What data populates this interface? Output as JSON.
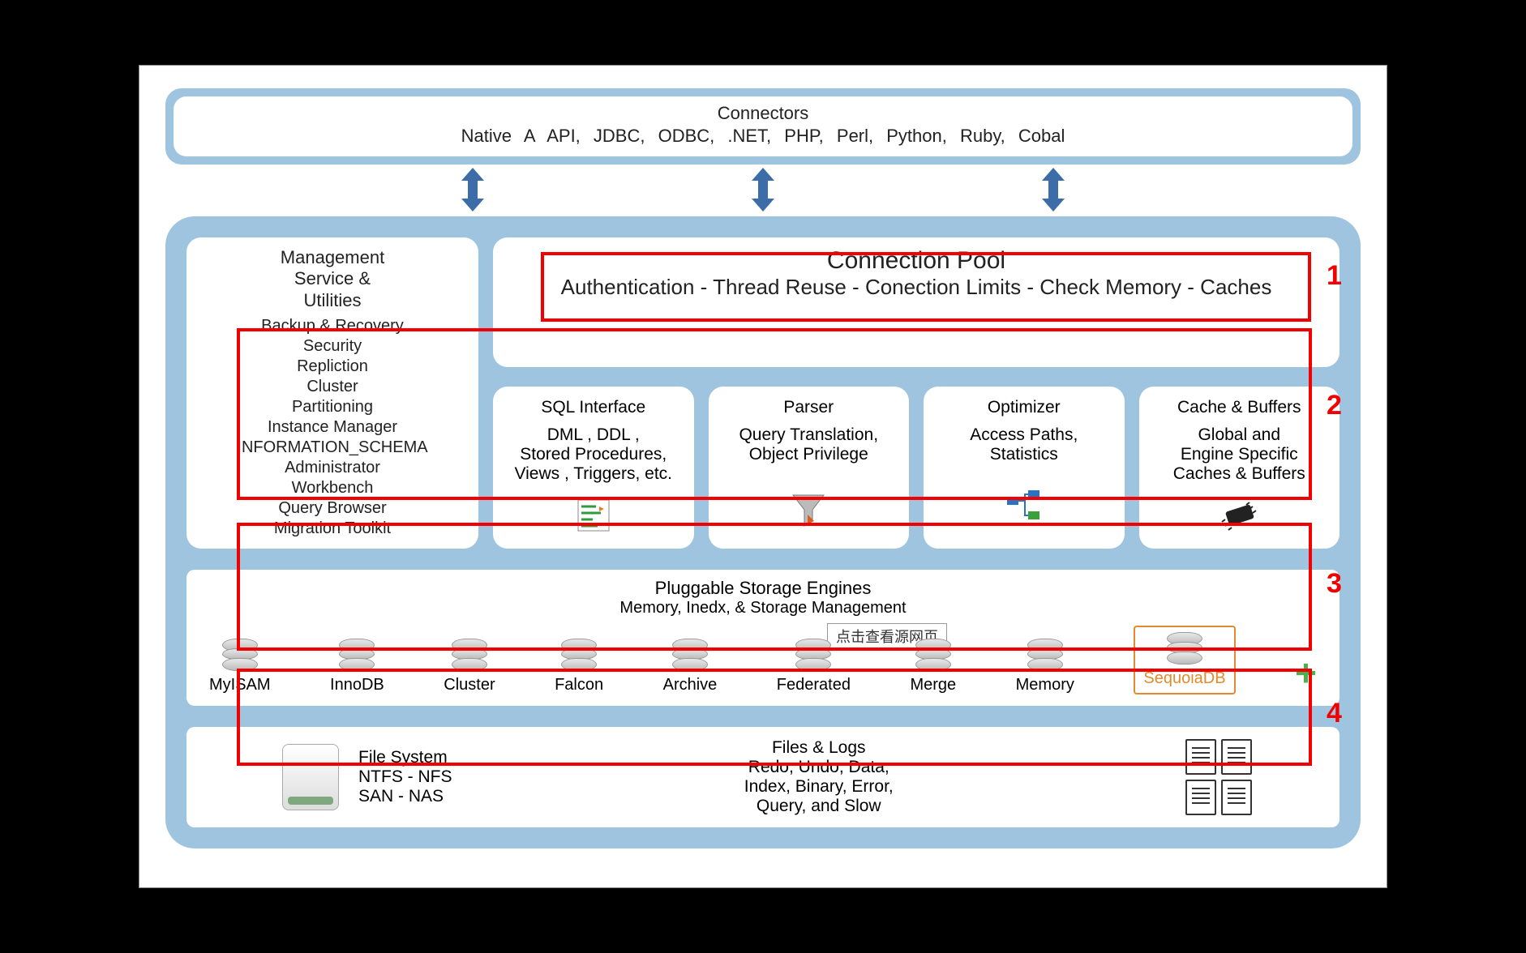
{
  "connectors": {
    "title": "Connectors",
    "list": "Native A  API,    JDBC,    ODBC,    .NET,    PHP,    Perl,    Python,    Ruby,    Cobal"
  },
  "management": {
    "title": "Management\nService &\nUtilities",
    "items": [
      "Backup & Recovery",
      "Security",
      "Repliction",
      "Cluster",
      "Partitioning",
      "Instance Manager",
      "INFORMATION_SCHEMA",
      "Administrator",
      "Workbench",
      "Query Browser",
      "Migration Toolkit"
    ]
  },
  "pool": {
    "title": "Connection Pool",
    "sub": "Authentication - Thread Reuse - Conection Limits - Check Memory - Caches"
  },
  "cells": [
    {
      "title": "SQL Interface",
      "desc": "DML , DDL ,\nStored Procedures,\nViews , Triggers, etc."
    },
    {
      "title": "Parser",
      "desc": "Query Translation,\nObject Privilege"
    },
    {
      "title": "Optimizer",
      "desc": "Access Paths,\nStatistics"
    },
    {
      "title": "Cache & Buffers",
      "desc": "Global and\nEngine Specific\nCaches & Buffers"
    }
  ],
  "engines": {
    "title": "Pluggable Storage Engines",
    "sub": "Memory, Inedx, & Storage Management",
    "items": [
      "MyISAM",
      "InnoDB",
      "Cluster",
      "Falcon",
      "Archive",
      "Federated",
      "Merge",
      "Memory",
      "SequoiaDB"
    ],
    "tooltip": "点击查看源网页",
    "plus": "+"
  },
  "filesystem": {
    "title": "File System",
    "lines": "NTFS - NFS\nSAN - NAS"
  },
  "fileslogs": {
    "title": "Files &  Logs",
    "lines": "Redo, Undo, Data,\nIndex, Binary,  Error,\nQuery,  and  Slow"
  },
  "overlays": {
    "n1": "1",
    "n2": "2",
    "n3": "3",
    "n4": "4"
  }
}
